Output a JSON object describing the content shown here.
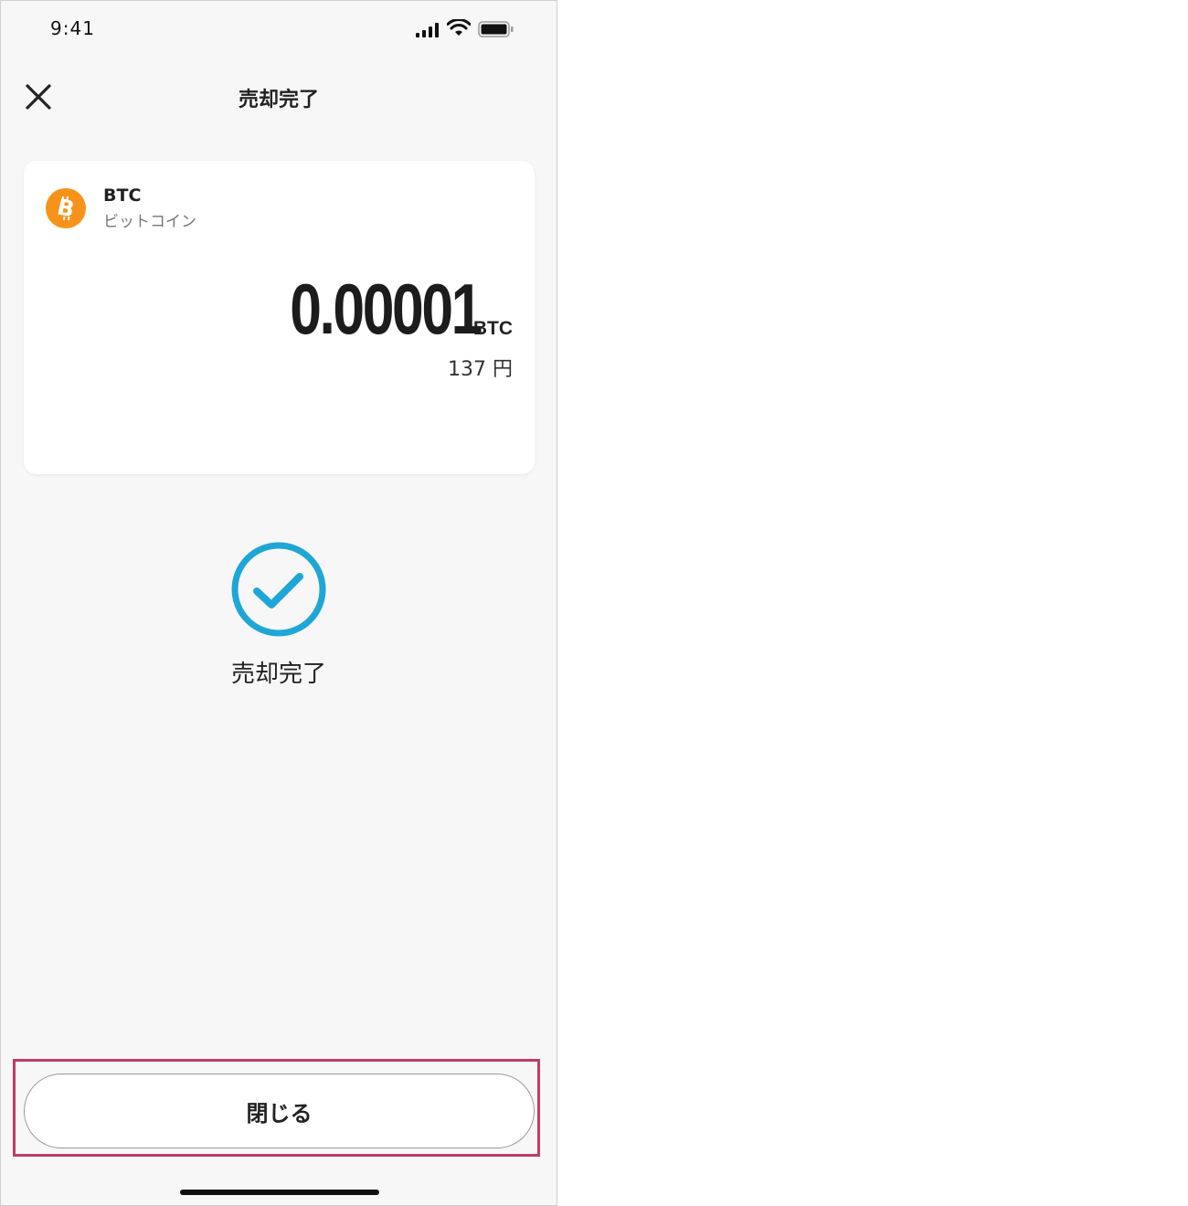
{
  "status_bar": {
    "time": "9:41",
    "icons": [
      "signal-icon",
      "wifi-icon",
      "battery-icon"
    ]
  },
  "nav": {
    "close_icon": "close-icon",
    "title": "売却完了"
  },
  "asset": {
    "icon": "bitcoin-icon",
    "icon_color": "#f7931a",
    "symbol": "BTC",
    "name": "ビットコイン",
    "amount": "0.00001",
    "amount_unit": "BTC",
    "fiat_value": "137 円"
  },
  "result": {
    "icon": "check-circle-icon",
    "icon_color": "#1ea7d6",
    "message": "売却完了"
  },
  "footer": {
    "close_label": "閉じる",
    "highlight_color": "#c23a69"
  }
}
